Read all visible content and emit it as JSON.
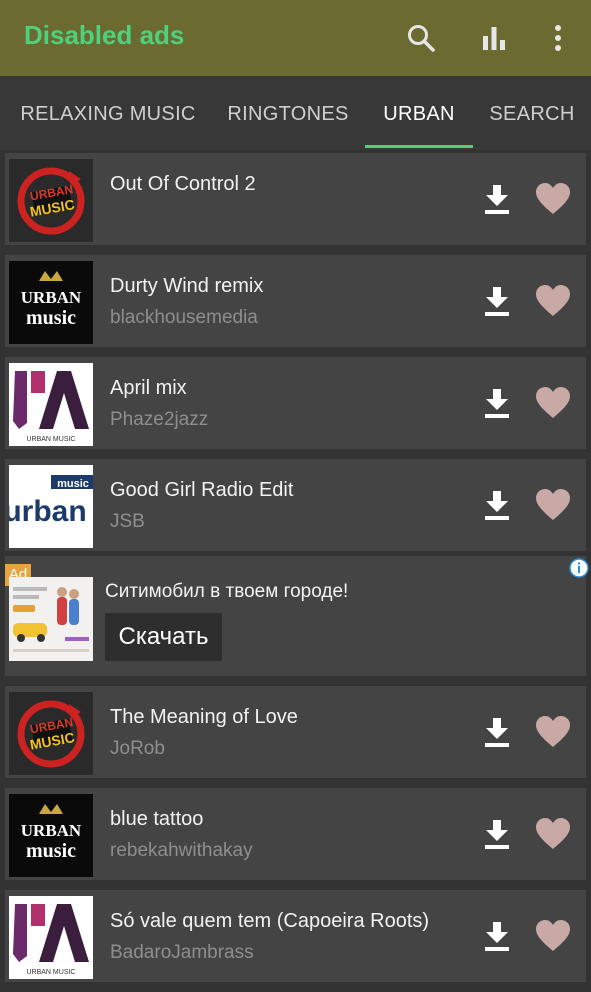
{
  "appbar": {
    "title": "Disabled ads",
    "icons": [
      "search-icon",
      "equalizer-icon",
      "more-vert-icon"
    ]
  },
  "tabs": [
    {
      "label": "RELAXING MUSIC",
      "active": false
    },
    {
      "label": "RINGTONES",
      "active": false
    },
    {
      "label": "URBAN",
      "active": true
    },
    {
      "label": "SEARCH",
      "active": false
    }
  ],
  "songs": [
    {
      "title": "Out Of Control 2",
      "artist": "",
      "art": "urban-music-red"
    },
    {
      "title": "Durty Wind remix",
      "artist": "blackhousemedia",
      "art": "urban-music-crown"
    },
    {
      "title": "April mix",
      "artist": "Phaze2jazz",
      "art": "ja-urban-music"
    },
    {
      "title": "Good Girl Radio Edit",
      "artist": "JSB",
      "art": "urban-blue"
    },
    {
      "title": "The Meaning of Love",
      "artist": "JoRob",
      "art": "urban-music-red"
    },
    {
      "title": "blue tattoo",
      "artist": "rebekahwithakay",
      "art": "urban-music-crown"
    },
    {
      "title": "Só vale quem tem (Capoeira Roots)",
      "artist": "BadaroJambrass",
      "art": "ja-urban-music"
    }
  ],
  "ad": {
    "badge": "Ad",
    "title": "Ситимобил в твоем городе!",
    "button": "Скачать"
  },
  "art_text": {
    "urban": "URBAN",
    "music": "music",
    "urban_music_caption": "URBAN MUSIC",
    "urban_music_lower": "URBAN",
    "music_word": "MUSIC",
    "urb": "urban"
  },
  "colors": {
    "appbar": "#6b6a31",
    "accent": "#4fd07c",
    "background": "#333333",
    "card": "#444444",
    "heart": "#c9a9a6"
  }
}
